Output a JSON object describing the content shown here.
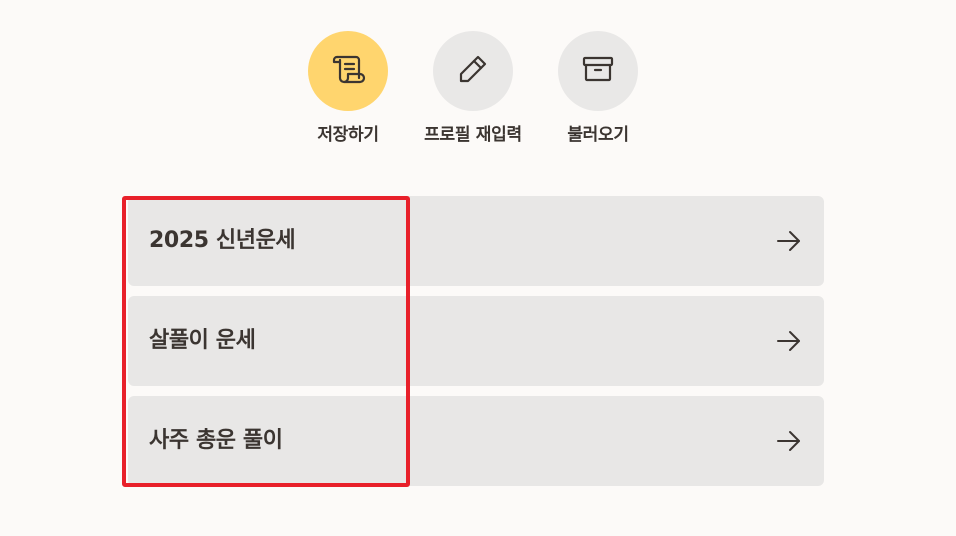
{
  "actions": {
    "save_label": "저장하기",
    "reprofile_label": "프로필 재입력",
    "load_label": "불러오기",
    "save_icon": "scroll-icon",
    "reprofile_icon": "pencil-icon",
    "load_icon": "archive-box-icon",
    "primary_color": "#ffd56e",
    "secondary_color": "#e9e8e7"
  },
  "menu": {
    "items": [
      {
        "label": "2025 신년운세",
        "icon": "arrow-right-icon"
      },
      {
        "label": "살풀이 운세",
        "icon": "arrow-right-icon"
      },
      {
        "label": "사주 총운 풀이",
        "icon": "arrow-right-icon"
      }
    ]
  },
  "highlight": {
    "color": "#e8202a"
  }
}
